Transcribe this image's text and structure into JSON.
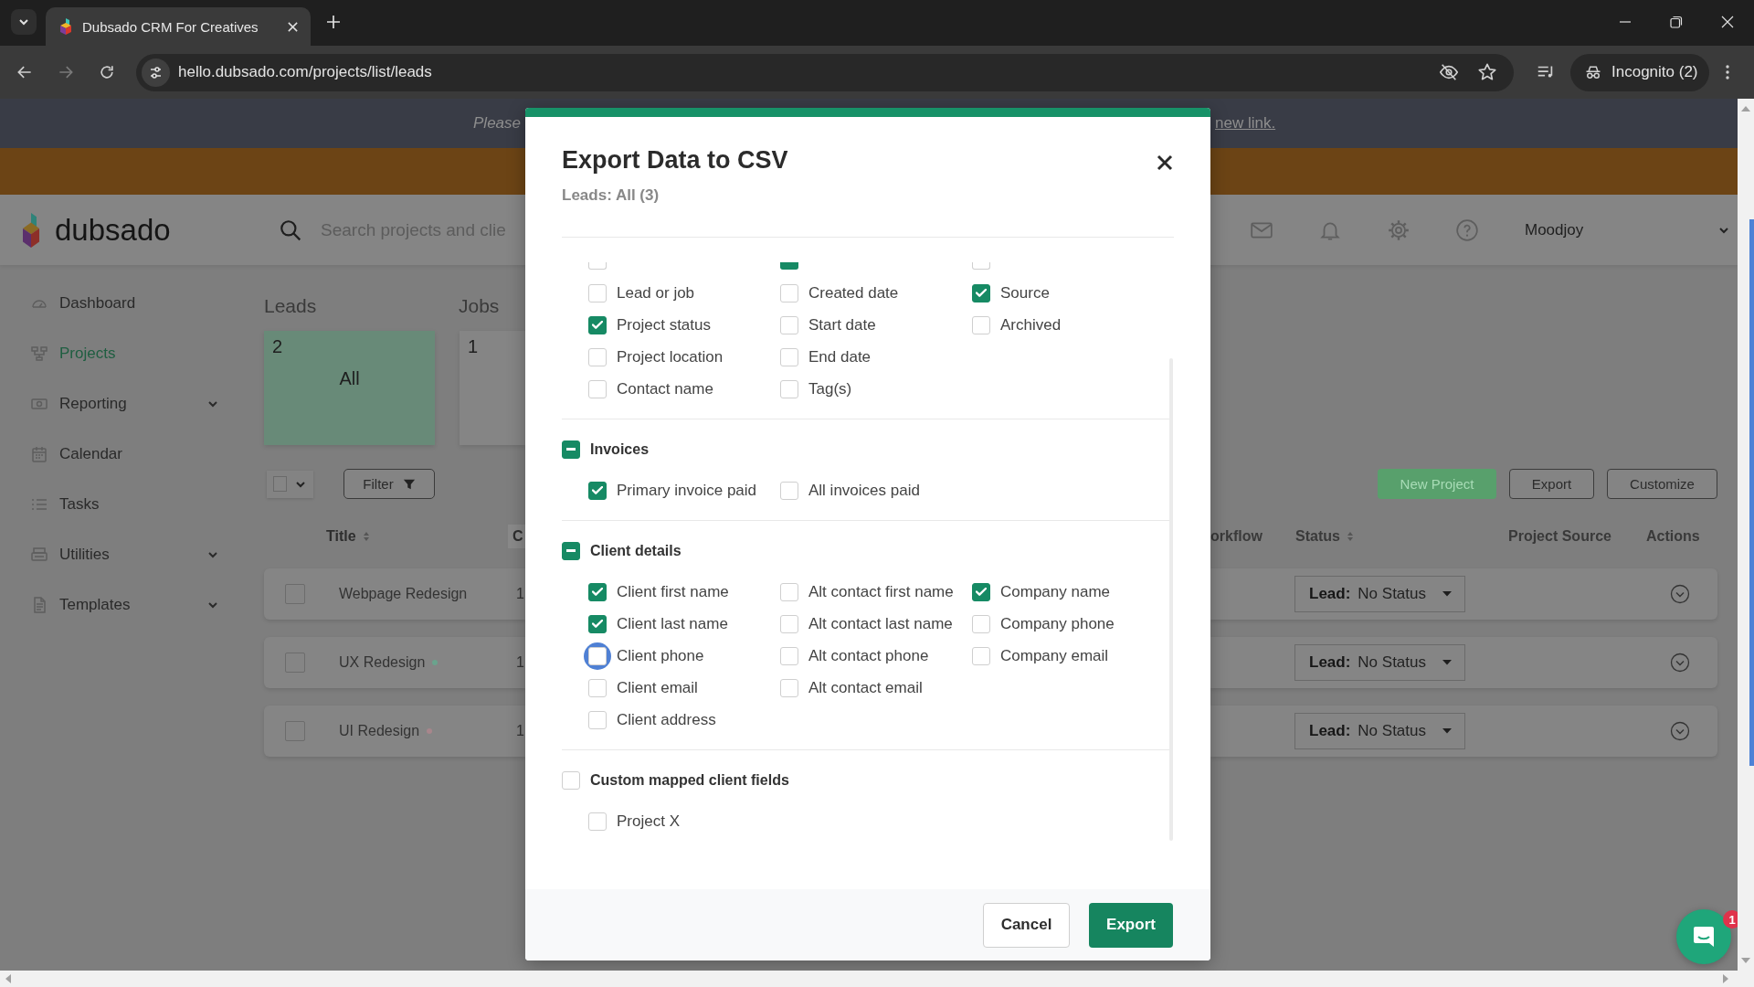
{
  "browser": {
    "tab_title": "Dubsado CRM For Creatives",
    "url": "hello.dubsado.com/projects/list/leads",
    "profile": "Incognito (2)"
  },
  "banner": {
    "text": "Please",
    "link": "new link."
  },
  "header": {
    "logo": "dubsado",
    "search": {
      "placeholder": "Search projects and clie"
    },
    "user": "Moodjoy"
  },
  "sidebar": {
    "items": [
      {
        "label": "Dashboard",
        "selected": false,
        "expandable": false
      },
      {
        "label": "Projects",
        "selected": true,
        "expandable": false
      },
      {
        "label": "Reporting",
        "selected": false,
        "expandable": true
      },
      {
        "label": "Calendar",
        "selected": false,
        "expandable": false
      },
      {
        "label": "Tasks",
        "selected": false,
        "expandable": false
      },
      {
        "label": "Utilities",
        "selected": false,
        "expandable": true
      },
      {
        "label": "Templates",
        "selected": false,
        "expandable": true
      }
    ]
  },
  "boards": [
    {
      "title": "Leads",
      "count": "2",
      "label": "All",
      "selected": true
    },
    {
      "title": "Jobs",
      "count": "1",
      "selected": false
    }
  ],
  "toolbar": {
    "select_all": {
      "checked": false
    },
    "filter": "Filter",
    "buttons": [
      {
        "label": "New Project",
        "kind": "primary"
      },
      {
        "label": "Export",
        "kind": "outline"
      },
      {
        "label": "Customize",
        "kind": "outline"
      }
    ]
  },
  "table": {
    "columns_left": [
      {
        "label": "Title",
        "sortable": true,
        "highlighted": false
      },
      {
        "label": "C",
        "sortable": false,
        "highlighted": true
      }
    ],
    "columns_right": [
      {
        "label": "orkflow",
        "sortable": false,
        "highlighted": false
      },
      {
        "label": "Status",
        "sortable": true,
        "highlighted": false
      },
      {
        "label": "Project Source",
        "sortable": false,
        "highlighted": false
      },
      {
        "label": "Actions",
        "sortable": false,
        "highlighted": false
      }
    ],
    "rows": [
      {
        "title": "Webpage Redesign",
        "checked": false,
        "column_2": "1",
        "stage": "Lead:",
        "status": "No Status"
      },
      {
        "title": "UX Redesign",
        "color": "#6aa38d",
        "checked": false,
        "column_2": "1",
        "stage": "Lead:",
        "status": "No Status"
      },
      {
        "title": "UI Redesign",
        "color": "#a8868c",
        "checked": false,
        "column_2": "1",
        "stage": "Lead:",
        "status": "No Status"
      }
    ]
  },
  "modal": {
    "title": "Export Data to CSV",
    "subtitle": "Leads: All (3)",
    "sections": [
      {
        "cut_row": [
          {
            "checked": false
          },
          {
            "checked": true
          },
          {
            "checked": false
          }
        ],
        "columns": [
          [
            {
              "label": "Lead or job",
              "checked": false,
              "hovered": false
            },
            {
              "label": "Project status",
              "checked": true,
              "hovered": false
            },
            {
              "label": "Project location",
              "checked": false,
              "hovered": false
            },
            {
              "label": "Contact name",
              "checked": false,
              "hovered": false
            }
          ],
          [
            {
              "label": "Created date",
              "checked": false,
              "hovered": false
            },
            {
              "label": "Start date",
              "checked": false,
              "hovered": false
            },
            {
              "label": "End date",
              "checked": false,
              "hovered": false
            },
            {
              "label": "Tag(s)",
              "checked": false,
              "hovered": false
            }
          ],
          [
            {
              "label": "Source",
              "checked": true,
              "hovered": false
            },
            {
              "label": "Archived",
              "checked": false,
              "hovered": false
            }
          ]
        ]
      },
      {
        "title": "Invoices",
        "indeterminate": true,
        "columns": [
          [
            {
              "label": "Primary invoice paid",
              "checked": true,
              "hovered": false
            }
          ],
          [
            {
              "label": "All invoices paid",
              "checked": false,
              "hovered": false
            }
          ]
        ]
      },
      {
        "title": "Client details",
        "indeterminate": true,
        "columns": [
          [
            {
              "label": "Client first name",
              "checked": true,
              "hovered": false
            },
            {
              "label": "Client last name",
              "checked": true,
              "hovered": false
            },
            {
              "label": "Client phone",
              "checked": false,
              "hovered": true
            },
            {
              "label": "Client email",
              "checked": false,
              "hovered": false
            },
            {
              "label": "Client address",
              "checked": false,
              "hovered": false
            }
          ],
          [
            {
              "label": "Alt contact first name",
              "checked": false,
              "hovered": false
            },
            {
              "label": "Alt contact last name",
              "checked": false,
              "hovered": false
            },
            {
              "label": "Alt contact phone",
              "checked": false,
              "hovered": false
            },
            {
              "label": "Alt contact email",
              "checked": false,
              "hovered": false
            }
          ],
          [
            {
              "label": "Company name",
              "checked": true,
              "hovered": false
            },
            {
              "label": "Company phone",
              "checked": false,
              "hovered": false
            },
            {
              "label": "Company email",
              "checked": false,
              "hovered": false
            }
          ]
        ]
      },
      {
        "title": "Custom mapped client fields",
        "indeterminate": false,
        "columns": [
          [
            {
              "label": "Project X",
              "checked": false,
              "hovered": false
            }
          ]
        ]
      }
    ],
    "buttons": [
      {
        "label": "Cancel",
        "kind": "secondary"
      },
      {
        "label": "Export",
        "kind": "primary"
      }
    ]
  },
  "chat": {
    "badge": "1"
  }
}
